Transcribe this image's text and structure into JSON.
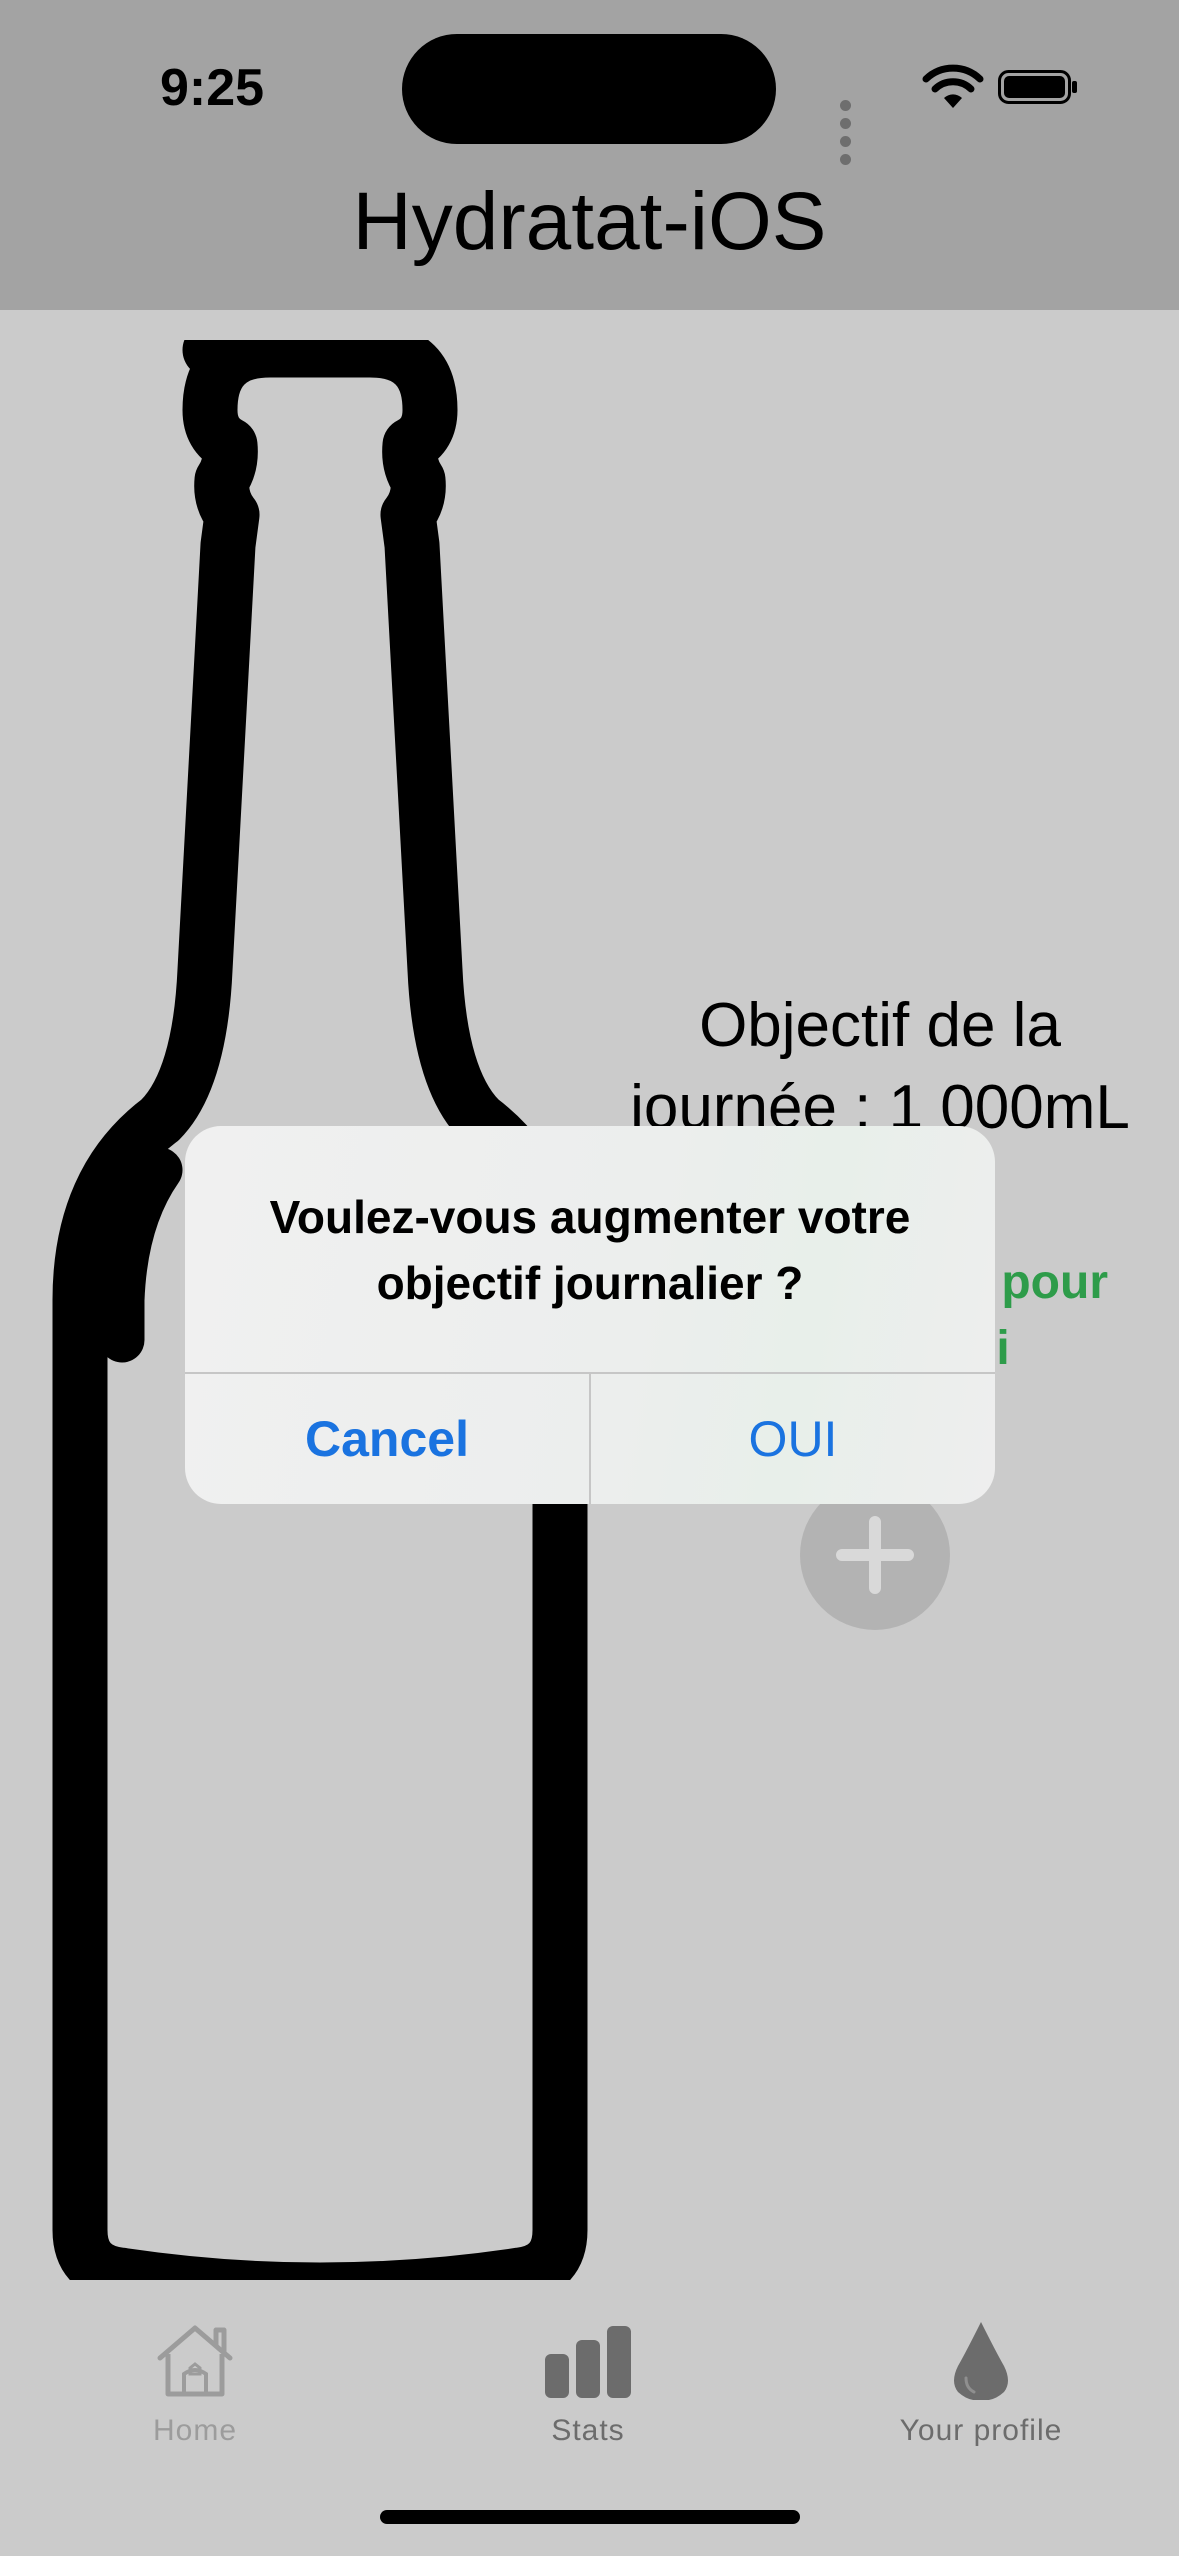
{
  "status_bar": {
    "time": "9:25"
  },
  "header": {
    "title": "Hydratat-iOS"
  },
  "main": {
    "objective_text": "Objectif  de la journée : 1 000mL",
    "done_text": "Objectif atteint pour aujourd'hui",
    "add_icon": "plus-icon"
  },
  "alert": {
    "message": "Voulez-vous augmenter votre objectif journalier ?",
    "cancel_label": "Cancel",
    "ok_label": "OUI"
  },
  "tabbar": {
    "items": [
      {
        "label": "Home",
        "icon": "house-icon"
      },
      {
        "label": "Stats",
        "icon": "bar-chart-icon"
      },
      {
        "label": "Your profile",
        "icon": "drop-icon"
      }
    ]
  },
  "colors": {
    "header_bg": "#a3a3a3",
    "body_bg": "#cbcbcb",
    "accent_blue": "#1a73e0",
    "success_green": "#2e9c4a"
  }
}
